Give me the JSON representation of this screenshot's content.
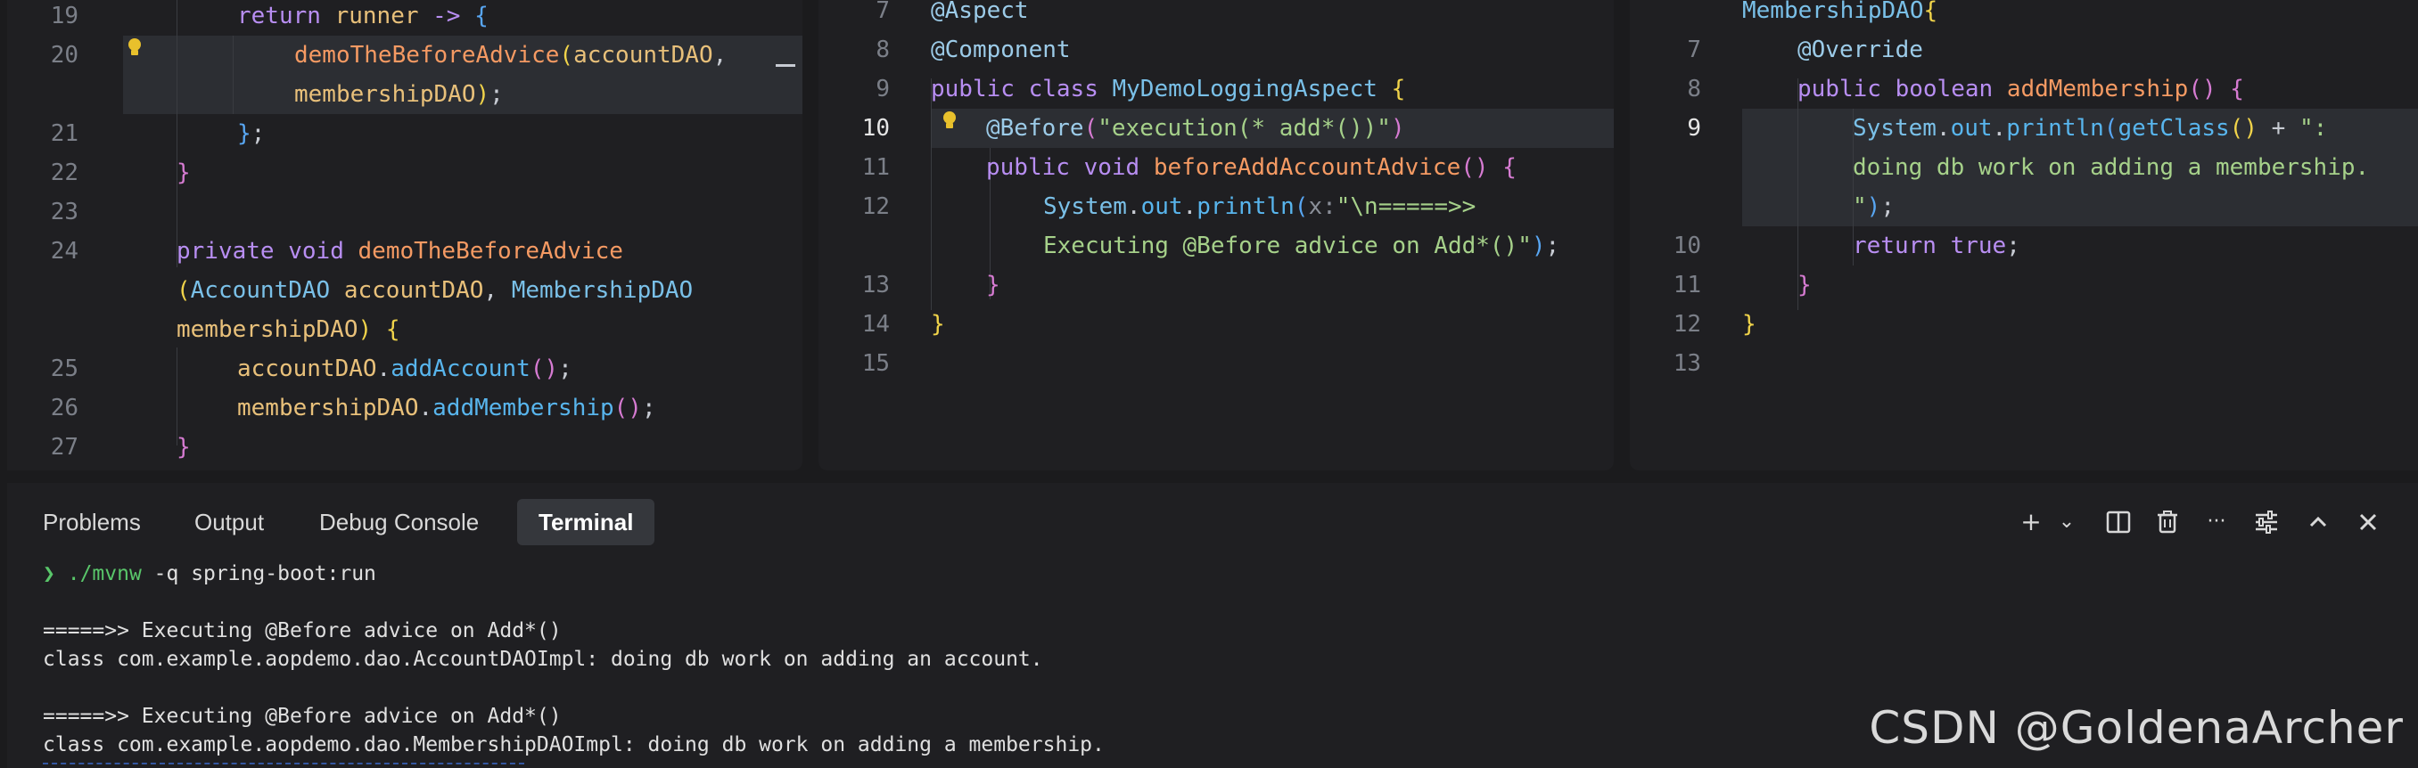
{
  "pane1": {
    "lines": [
      {
        "n": "19",
        "segs": [
          [
            "kw",
            "return "
          ],
          [
            "va",
            "runner "
          ],
          [
            "kw",
            "-> "
          ],
          [
            "br3",
            "{"
          ]
        ]
      },
      {
        "n": "20",
        "segs": [
          [
            "fn",
            "demoTheBeforeAdvice"
          ],
          [
            "br1",
            "("
          ],
          [
            "va",
            "accountDAO"
          ],
          [
            "pl",
            ","
          ]
        ]
      },
      {
        "n": "",
        "segs": [
          [
            "va",
            "membershipDAO"
          ],
          [
            "br1",
            ")"
          ],
          [
            "pl",
            ";"
          ]
        ]
      },
      {
        "n": "21",
        "segs": [
          [
            "br3",
            "}"
          ],
          [
            "pl",
            ";"
          ]
        ]
      },
      {
        "n": "22",
        "segs": [
          [
            "br2",
            "}"
          ]
        ]
      },
      {
        "n": "23",
        "segs": []
      },
      {
        "n": "24",
        "segs": [
          [
            "kw",
            "private "
          ],
          [
            "kw",
            "void "
          ],
          [
            "fn",
            "demoTheBeforeAdvice"
          ]
        ]
      },
      {
        "n": "",
        "segs": [
          [
            "br1",
            "("
          ],
          [
            "ty",
            "AccountDAO "
          ],
          [
            "va",
            "accountDAO"
          ],
          [
            "pl",
            ", "
          ],
          [
            "ty",
            "MembershipDAO"
          ]
        ]
      },
      {
        "n": "",
        "segs": [
          [
            "va",
            "membershipDAO"
          ],
          [
            "br1",
            ") "
          ],
          [
            "br1",
            "{"
          ]
        ]
      },
      {
        "n": "25",
        "segs": [
          [
            "va",
            "accountDAO"
          ],
          [
            "pl",
            "."
          ],
          [
            "me",
            "addAccount"
          ],
          [
            "br2",
            "()"
          ],
          [
            "pl",
            ";"
          ]
        ]
      },
      {
        "n": "26",
        "segs": [
          [
            "va",
            "membershipDAO"
          ],
          [
            "pl",
            "."
          ],
          [
            "me",
            "addMembership"
          ],
          [
            "br2",
            "()"
          ],
          [
            "pl",
            ";"
          ]
        ]
      },
      {
        "n": "27",
        "segs": [
          [
            "br2",
            "}"
          ]
        ]
      }
    ]
  },
  "pane2": {
    "lines": [
      {
        "n": "7",
        "segs": [
          [
            "an",
            "@Aspect"
          ]
        ]
      },
      {
        "n": "8",
        "segs": [
          [
            "an",
            "@Component"
          ]
        ]
      },
      {
        "n": "9",
        "segs": [
          [
            "kw",
            "public "
          ],
          [
            "kw",
            "class "
          ],
          [
            "ty",
            "MyDemoLoggingAspect "
          ],
          [
            "br1",
            "{"
          ]
        ]
      },
      {
        "n": "10",
        "segs": [
          [
            "an",
            "@Before"
          ],
          [
            "br2",
            "("
          ],
          [
            "st",
            "\"execution(* add*())\""
          ],
          [
            "br2",
            ")"
          ]
        ]
      },
      {
        "n": "11",
        "segs": [
          [
            "kw",
            "public "
          ],
          [
            "kw",
            "void "
          ],
          [
            "fn",
            "beforeAddAccountAdvice"
          ],
          [
            "br2",
            "() "
          ],
          [
            "br2",
            "{"
          ]
        ]
      },
      {
        "n": "12",
        "segs": [
          [
            "ty",
            "System"
          ],
          [
            "pl",
            "."
          ],
          [
            "fd",
            "out"
          ],
          [
            "pl",
            "."
          ],
          [
            "me",
            "println"
          ],
          [
            "br3",
            "("
          ],
          [
            "pr",
            "x:"
          ],
          [
            "st",
            "\"\\n=====>>"
          ]
        ]
      },
      {
        "n": "",
        "segs": [
          [
            "st",
            "Executing @Before advice on Add*()\""
          ],
          [
            "br3",
            ")"
          ],
          [
            "pl",
            ";"
          ]
        ]
      },
      {
        "n": "13",
        "segs": [
          [
            "br2",
            "}"
          ]
        ]
      },
      {
        "n": "14",
        "segs": [
          [
            "br1",
            "}"
          ]
        ]
      },
      {
        "n": "15",
        "segs": []
      }
    ]
  },
  "pane3": {
    "lines": [
      {
        "n": "",
        "segs": [
          [
            "ty",
            "MembershipDAO"
          ],
          [
            "br1",
            "{"
          ]
        ]
      },
      {
        "n": "7",
        "segs": [
          [
            "an",
            "@Override"
          ]
        ]
      },
      {
        "n": "8",
        "segs": [
          [
            "kw",
            "public "
          ],
          [
            "kw",
            "boolean "
          ],
          [
            "fn",
            "addMembership"
          ],
          [
            "br2",
            "() "
          ],
          [
            "br2",
            "{"
          ]
        ]
      },
      {
        "n": "9",
        "segs": [
          [
            "ty",
            "System"
          ],
          [
            "pl",
            "."
          ],
          [
            "fd",
            "out"
          ],
          [
            "pl",
            "."
          ],
          [
            "me",
            "println"
          ],
          [
            "br3",
            "("
          ],
          [
            "me",
            "getClass"
          ],
          [
            "br1",
            "()"
          ],
          [
            "pl",
            " + "
          ],
          [
            "st",
            "\":"
          ]
        ]
      },
      {
        "n": "",
        "segs": [
          [
            "st",
            "doing db work on adding a membership."
          ]
        ]
      },
      {
        "n": "",
        "segs": [
          [
            "st",
            "\""
          ],
          [
            "br3",
            ")"
          ],
          [
            "pl",
            ";"
          ]
        ]
      },
      {
        "n": "10",
        "segs": [
          [
            "kw",
            "return "
          ],
          [
            "kw",
            "true"
          ],
          [
            "pl",
            ";"
          ]
        ]
      },
      {
        "n": "11",
        "segs": [
          [
            "br2",
            "}"
          ]
        ]
      },
      {
        "n": "12",
        "segs": [
          [
            "br1",
            "}"
          ]
        ]
      },
      {
        "n": "13",
        "segs": []
      }
    ]
  },
  "panel": {
    "tabs": [
      "Problems",
      "Output",
      "Debug Console",
      "Terminal"
    ],
    "active_tab": "Terminal",
    "tools": [
      "+",
      "⌄",
      "◫",
      "🗑",
      "···",
      "☰",
      "⌃",
      "✕"
    ]
  },
  "terminal": {
    "prompt": "❯",
    "cmd_prefix": "./mvnw",
    "cmd_rest": " -q spring-boot:run",
    "lines": [
      "=====>> Executing @Before advice on Add*()",
      "class com.example.aopdemo.dao.AccountDAOImpl: doing db work on adding an account.",
      "",
      "=====>> Executing @Before advice on Add*()",
      "class com.example.aopdemo.dao.MembershipDAOImpl: doing db work on adding a membership."
    ]
  },
  "watermark": "CSDN @GoldenaArcher",
  "colors": {
    "background": "#1b1b1d",
    "editor": "#1f1f22",
    "highlight": "#2c2e33",
    "keyword": "#b88ef2",
    "function": "#f59a63",
    "string": "#a6d18a",
    "prompt": "#59c66a"
  }
}
